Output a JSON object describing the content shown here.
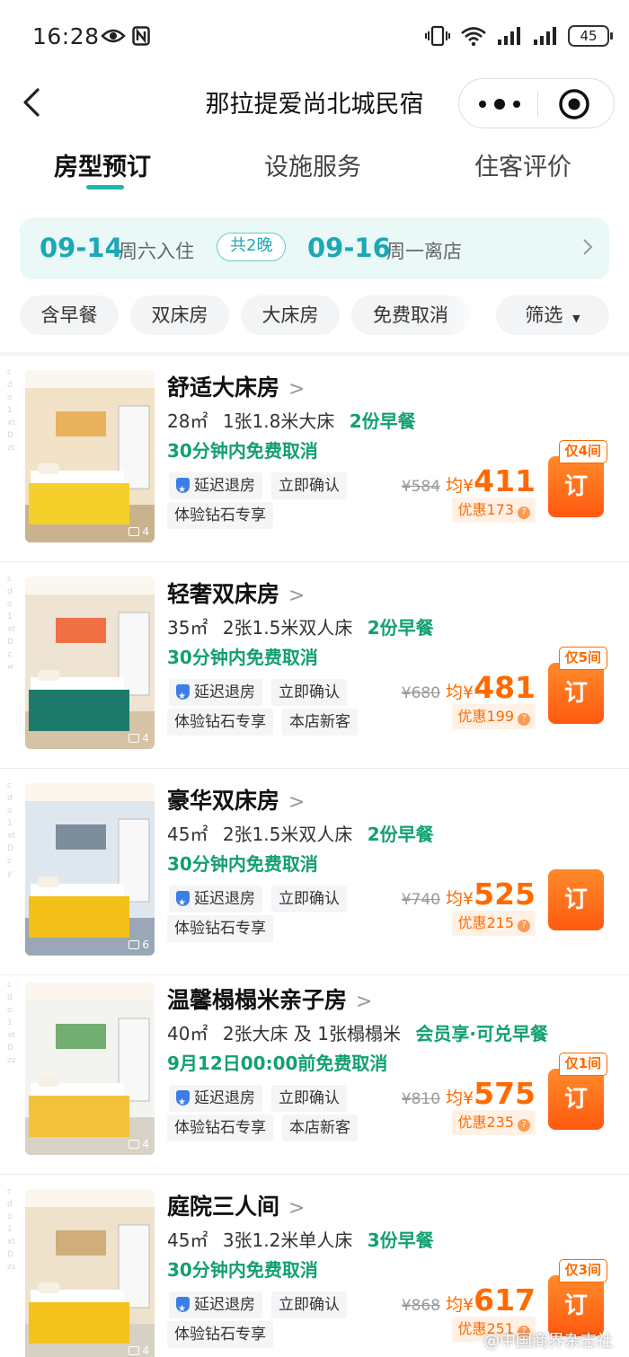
{
  "status_bar": {
    "time": "16:28",
    "battery": "45"
  },
  "header": {
    "title": "那拉提爱尚北城民宿"
  },
  "tabs": [
    {
      "label": "房型预订",
      "active": true
    },
    {
      "label": "设施服务",
      "active": false
    },
    {
      "label": "住客评价",
      "active": false
    }
  ],
  "dates": {
    "checkin_date": "09-14",
    "checkin_label": "周六入住",
    "nights": "共2晚",
    "checkout_date": "09-16",
    "checkout_label": "周一离店"
  },
  "filters": [
    "含早餐",
    "双床房",
    "大床房",
    "免费取消",
    "筛选"
  ],
  "rooms": [
    {
      "name": "舒适大床房",
      "area": "28㎡",
      "beds": "1张1.8米大床",
      "breakfast": "2份早餐",
      "cancel": "30分钟内免费取消",
      "tags": [
        "延迟退房",
        "立即确认",
        "体验钻石专享"
      ],
      "orig_price": "¥584",
      "avg_label": "均¥",
      "price": "411",
      "saving": "优惠173",
      "stock": "仅4间",
      "book": "订",
      "photos": "4",
      "code": "cdo1xtDzt"
    },
    {
      "name": "轻奢双床房",
      "area": "35㎡",
      "beds": "2张1.5米双人床",
      "breakfast": "2份早餐",
      "cancel": "30分钟内免费取消",
      "tags": [
        "延迟退房",
        "立即确认",
        "体验钻石专享",
        "本店新客"
      ],
      "orig_price": "¥680",
      "avg_label": "均¥",
      "price": "481",
      "saving": "优惠199",
      "stock": "仅5间",
      "book": "订",
      "photos": "4",
      "code": "cdo1xtDzw"
    },
    {
      "name": "豪华双床房",
      "area": "45㎡",
      "beds": "2张1.5米双人床",
      "breakfast": "2份早餐",
      "cancel": "30分钟内免费取消",
      "tags": [
        "延迟退房",
        "立即确认",
        "体验钻石专享"
      ],
      "orig_price": "¥740",
      "avg_label": "均¥",
      "price": "525",
      "saving": "优惠215",
      "stock": "",
      "book": "订",
      "photos": "6",
      "code": "cdo1xtDzy"
    },
    {
      "name": "温馨榻榻米亲子房",
      "area": "40㎡",
      "beds": "2张大床 及 1张榻榻米",
      "breakfast": "会员享·可兑早餐",
      "cancel": "9月12日00:00前免费取消",
      "tags": [
        "延迟退房",
        "立即确认",
        "体验钻石专享",
        "本店新客"
      ],
      "orig_price": "¥810",
      "avg_label": "均¥",
      "price": "575",
      "saving": "优惠235",
      "stock": "仅1间",
      "book": "订",
      "photos": "4",
      "code": "cdo1xtDzz"
    },
    {
      "name": "庭院三人间",
      "area": "45㎡",
      "beds": "3张1.2米单人床",
      "breakfast": "3份早餐",
      "cancel": "30分钟内免费取消",
      "tags": [
        "延迟退房",
        "立即确认",
        "体验钻石专享"
      ],
      "orig_price": "¥868",
      "avg_label": "均¥",
      "price": "617",
      "saving": "优惠251",
      "stock": "仅3间",
      "book": "订",
      "photos": "4",
      "code": "cdo1xtDzs"
    }
  ],
  "watermark": "@中国商界杂志社",
  "colors": {
    "teal": "#1fb7b0",
    "green": "#12a06f",
    "orange": "#ff6a00"
  }
}
